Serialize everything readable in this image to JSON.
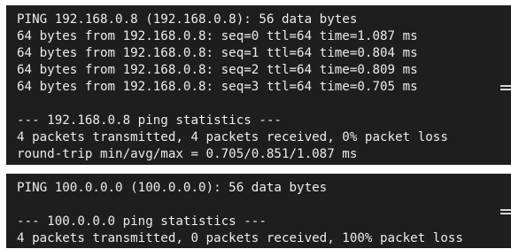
{
  "colors": {
    "terminal_background": "#1e1e1e",
    "terminal_text": "#ececec",
    "page_background": "#ffffff",
    "scroll_handle": "#d6d6d6"
  },
  "icons": {
    "scroll_handle": "drag-handle-icon"
  },
  "terminal1": {
    "lines": [
      "PING 192.168.0.8 (192.168.0.8): 56 data bytes",
      "64 bytes from 192.168.0.8: seq=0 ttl=64 time=1.087 ms",
      "64 bytes from 192.168.0.8: seq=1 ttl=64 time=0.804 ms",
      "64 bytes from 192.168.0.8: seq=2 ttl=64 time=0.809 ms",
      "64 bytes from 192.168.0.8: seq=3 ttl=64 time=0.705 ms",
      "",
      "--- 192.168.0.8 ping statistics ---",
      "4 packets transmitted, 4 packets received, 0% packet loss",
      "round-trip min/avg/max = 0.705/0.851/1.087 ms"
    ]
  },
  "terminal2": {
    "lines": [
      "PING 100.0.0.0 (100.0.0.0): 56 data bytes",
      "",
      "--- 100.0.0.0 ping statistics ---",
      "4 packets transmitted, 0 packets received, 100% packet loss"
    ]
  }
}
